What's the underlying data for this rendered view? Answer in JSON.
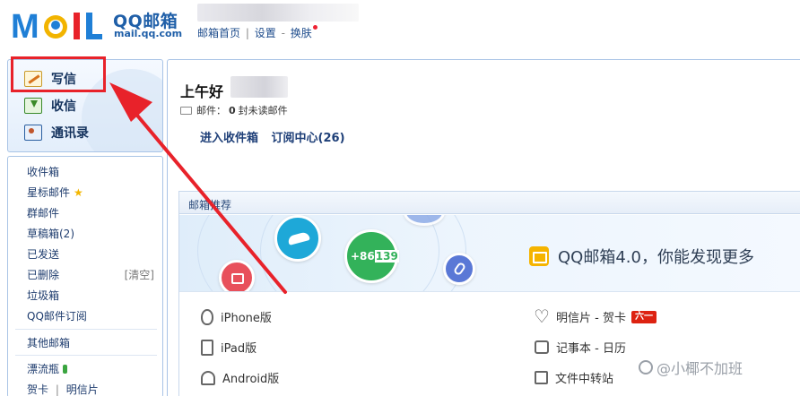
{
  "header": {
    "brand_name": "QQ邮箱",
    "brand_domain": "mail.qq.com",
    "links": [
      "邮箱首页",
      "设置",
      "换肤"
    ],
    "separator_pipe": "|",
    "separator_dash": "-"
  },
  "sidebar": {
    "primary": [
      {
        "label": "写信",
        "icon": "write-icon"
      },
      {
        "label": "收信",
        "icon": "inbox-icon"
      },
      {
        "label": "通讯录",
        "icon": "contacts-icon"
      }
    ],
    "folders": {
      "inbox": "收件箱",
      "starred": "星标邮件",
      "group": "群邮件",
      "drafts": "草稿箱(2)",
      "sent": "已发送",
      "deleted": "已删除",
      "clear": "[清空]",
      "spam": "垃圾箱",
      "subscriptions": "QQ邮件订阅",
      "other": "其他邮箱",
      "drift": "漂流瓶",
      "greeting_card": "贺卡",
      "postcard": "明信片",
      "pipe": "|"
    },
    "highlight_color": "#e8222a"
  },
  "main": {
    "greeting": "上午好",
    "mail_label": "邮件：",
    "unread_count": "0",
    "unread_suffix": "封未读邮件",
    "link_inbox": "进入收件箱",
    "link_subscriptions": "订阅中心(26)",
    "recommend_title": "邮箱推荐",
    "banner_phone": "+86",
    "banner_phone_digits": "139",
    "promo_text": "QQ邮箱4.0，你能发现更多",
    "apps_left": [
      "iPhone版",
      "iPad版",
      "Android版"
    ],
    "apps_right": [
      {
        "label": "明信片 - 贺卡",
        "badge": "六一"
      },
      {
        "label": "记事本 - 日历"
      },
      {
        "label": "文件中转站"
      }
    ]
  },
  "watermark": "@小椰不加班",
  "colors": {
    "accent_blue": "#1f5fa8",
    "link_blue": "#1e3f78",
    "border_blue": "#a9c4e6",
    "arrow_red": "#e8222a"
  }
}
